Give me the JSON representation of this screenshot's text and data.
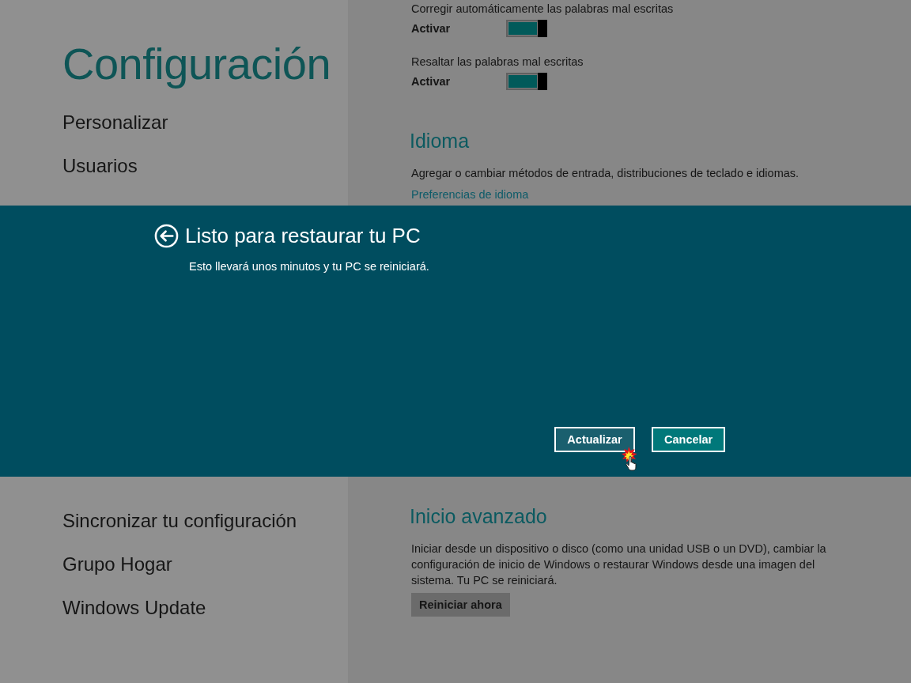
{
  "settings_panel": {
    "title": "Configuración",
    "nav_items_above": [
      {
        "label": "Personalizar"
      },
      {
        "label": "Usuarios"
      }
    ],
    "nav_items_below": [
      {
        "label": "Sincronizar tu configuración"
      },
      {
        "label": "Grupo Hogar"
      },
      {
        "label": "Windows Update"
      }
    ]
  },
  "content": {
    "toggles": [
      {
        "description": "Corregir automáticamente las palabras mal escritas",
        "label": "Activar",
        "on": true
      },
      {
        "description": "Resaltar las palabras mal escritas",
        "label": "Activar",
        "on": true
      }
    ],
    "language": {
      "heading": "Idioma",
      "text": "Agregar o cambiar métodos de entrada, distribuciones de teclado e idiomas.",
      "link": "Preferencias de idioma"
    },
    "advanced_startup": {
      "heading": "Inicio avanzado",
      "text": "Iniciar desde un dispositivo o disco (como una unidad USB o un DVD), cambiar la configuración de inicio de Windows o restaurar Windows desde una imagen del sistema. Tu PC se reiniciará.",
      "button": "Reiniciar ahora"
    }
  },
  "dialog": {
    "title": "Listo para restaurar tu PC",
    "message": "Esto llevará unos minutos y tu PC se reiniciará.",
    "buttons": [
      {
        "label": "Actualizar",
        "kind": "primary"
      },
      {
        "label": "Cancelar",
        "kind": "secondary"
      }
    ]
  }
}
